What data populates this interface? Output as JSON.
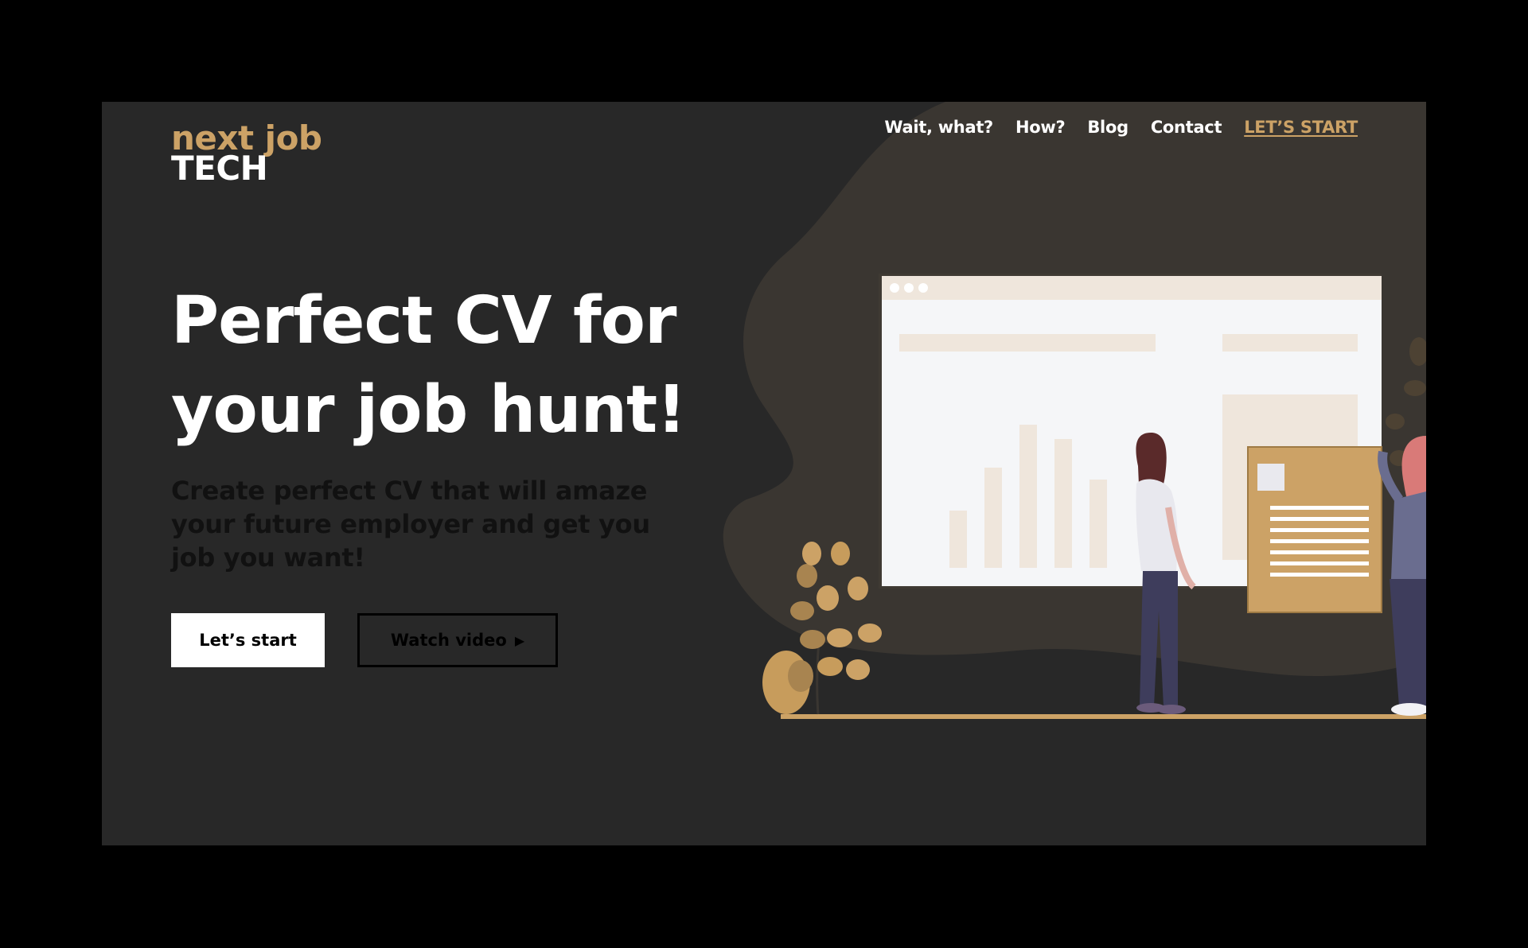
{
  "logo": {
    "line1": "next job",
    "line2": "TECH"
  },
  "nav": {
    "items": [
      "Wait, what?",
      "How?",
      "Blog",
      "Contact"
    ],
    "cta": "LET’S START"
  },
  "hero": {
    "title": "Perfect CV for your job hunt!",
    "subtitle": "Create perfect CV that will amaze your future employer and get you job you want!",
    "primary_button": "Let’s start",
    "secondary_button": "Watch video",
    "play_icon": "▶"
  },
  "colors": {
    "background": "#282828",
    "accent": "#cca266",
    "blob": "#3a3631",
    "text": "#ffffff"
  }
}
